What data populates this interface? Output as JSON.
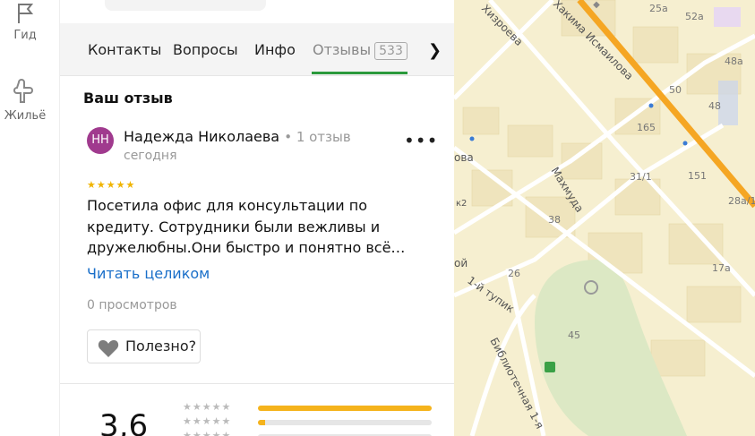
{
  "rail": {
    "guide_label": "Гид",
    "housing_label": "Жильё"
  },
  "tabs": [
    {
      "label": "Контакты"
    },
    {
      "label": "Вопросы"
    },
    {
      "label": "Инфо"
    },
    {
      "label": "Отзывы",
      "badge": "533",
      "active": true
    }
  ],
  "review": {
    "section_title": "Ваш отзыв",
    "avatar_initials": "НН",
    "avatar_color": "#a03a8e",
    "author": "Надежда Николаева",
    "author_meta": "• 1 отзыв",
    "date": "сегодня",
    "stars": "★★★★★",
    "text": "Посетила офис для консультации по кредиту. Сотрудники были вежливы и дружелюбны.Они быстро и понятно всё…",
    "read_more": "Читать целиком",
    "views": "0 просмотров",
    "useful_label": "Полезно?",
    "more_icon": "•••"
  },
  "rating": {
    "value": "3,6",
    "distribution": [
      {
        "stars": "★★★★★",
        "fraction": 1.0
      },
      {
        "stars": "★★★★★",
        "fraction": 0.04
      },
      {
        "stars": "★★★★★",
        "fraction": 0.0
      }
    ]
  },
  "map": {
    "streets": [
      "Хизроева",
      "Хакима Исмаилова",
      "Махмуда",
      "1-й тупик",
      "Библиотечная 1-я"
    ],
    "street_fragments": [
      "ова",
      "ой",
      "к2"
    ],
    "house_numbers": [
      "25а",
      "52а",
      "48а",
      "50",
      "48",
      "165",
      "31/1",
      "151",
      "28а/1",
      "38",
      "17а",
      "26",
      "45"
    ],
    "colors": {
      "road_major": "#f5a623",
      "background": "#f6efd0",
      "park": "#dce8c4"
    }
  }
}
